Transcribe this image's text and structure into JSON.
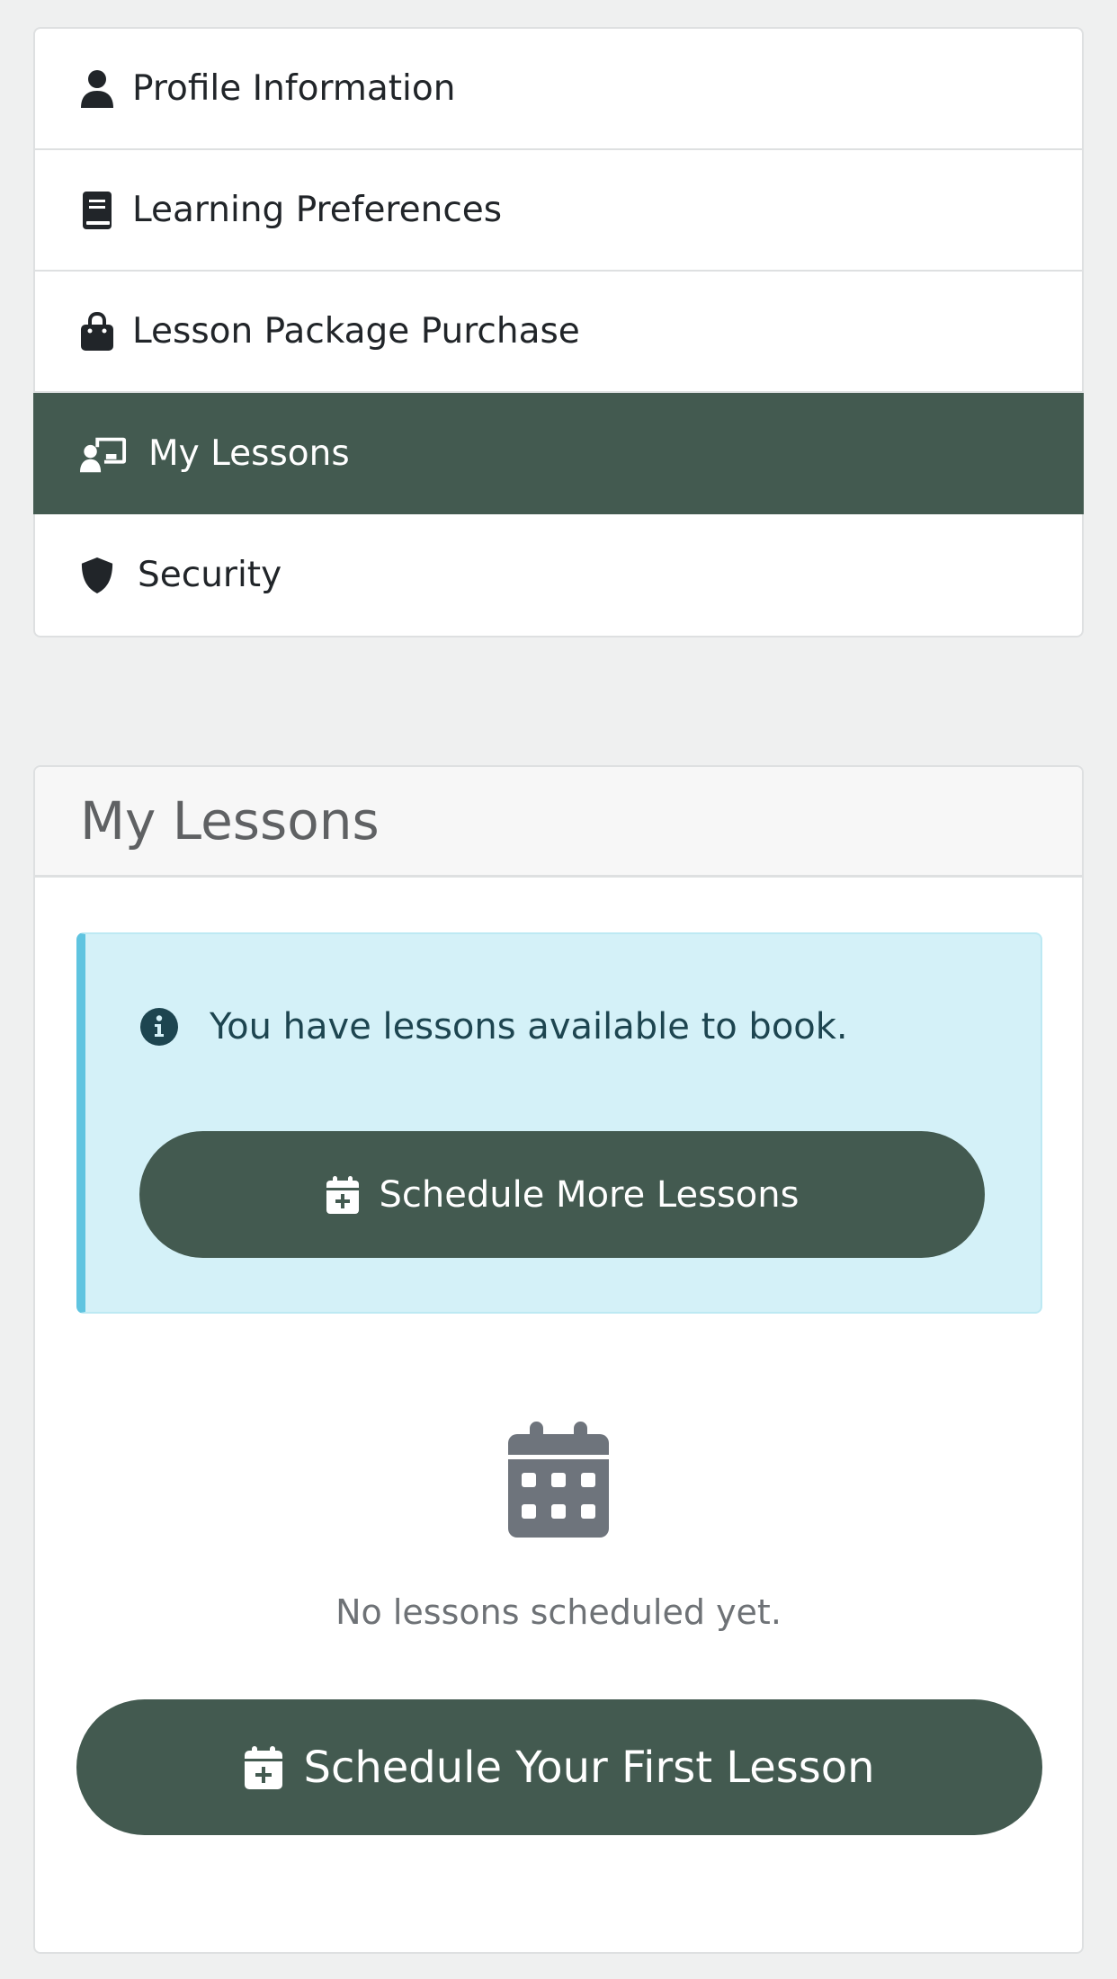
{
  "sidebar": {
    "items": [
      {
        "label": "Profile Information",
        "icon": "user-icon",
        "active": false
      },
      {
        "label": "Learning Preferences",
        "icon": "book-icon",
        "active": false
      },
      {
        "label": "Lesson Package Purchase",
        "icon": "shopping-bag-icon",
        "active": false
      },
      {
        "label": "My Lessons",
        "icon": "chalkboard-user-icon",
        "active": true
      },
      {
        "label": "Security",
        "icon": "shield-icon",
        "active": false
      }
    ]
  },
  "lessons_card": {
    "title": "My Lessons",
    "alert": {
      "icon": "info-circle-icon",
      "message": "You have lessons available to book.",
      "button_icon": "calendar-plus-icon",
      "button_label": "Schedule More Lessons"
    },
    "empty_state": {
      "icon": "calendar-icon",
      "message": "No lessons scheduled yet.",
      "button_icon": "calendar-plus-icon",
      "button_label": "Schedule Your First Lesson"
    }
  },
  "colors": {
    "primary": "#435a50",
    "page_background": "#eff0f0",
    "alert_background": "#d4f1f8",
    "alert_accent": "#5fc4e0",
    "muted_icon": "#6e747c"
  }
}
